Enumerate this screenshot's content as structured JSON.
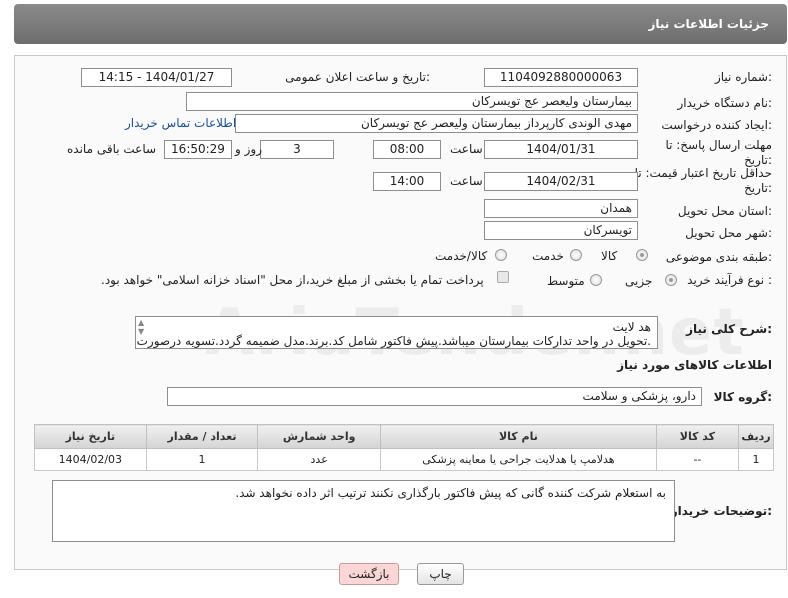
{
  "header": {
    "title": "جزئیات اطلاعات نیاز"
  },
  "form": {
    "need_number_label": "شماره نیاز:",
    "need_number": "1104092880000063",
    "announce_label": "تاریخ و ساعت اعلان عمومی:",
    "announce_value": "1404/01/27 - 14:15",
    "buyer_org_label": "نام دستگاه خریدار:",
    "buyer_org": "بیمارستان ولیعصر  عج  تویسرکان",
    "creator_label": "ایجاد کننده درخواست:",
    "creator": "مهدی الوندی کارپرداز بیمارستان ولیعصر  عج  تویسرکان",
    "contact_link": "اطلاعات تماس خریدار",
    "reply_deadline_label": "مهلت ارسال پاسخ: تا تاریخ:",
    "reply_date": "1404/01/31",
    "time_label": "ساعت",
    "reply_time": "08:00",
    "days_value": "3",
    "days_label": "روز و",
    "remaining_time": "16:50:29",
    "remaining_label": "ساعت باقی مانده",
    "price_deadline_label": "حداقل تاریخ اعتبار قیمت: تا تاریخ:",
    "price_date": "1404/02/31",
    "price_time": "14:00",
    "province_label": "استان محل تحویل:",
    "province": "همدان",
    "city_label": "شهر محل تحویل:",
    "city": "تویسرکان",
    "category_label": "طبقه بندی موضوعی:",
    "category_options": [
      "کالا",
      "خدمت",
      "کالا/خدمت"
    ],
    "process_label": "نوع فرآیند خرید :",
    "process_options": [
      "جزیی",
      "متوسط"
    ],
    "payment_note": "پرداخت تمام یا بخشی از مبلغ خرید،از محل \"اسناد خزانه اسلامی\" خواهد بود."
  },
  "description": {
    "label": "شرح کلی نیاز:",
    "line1": "هد لایت",
    "line2": ".تحویل در واحد تدارکات بیمارستان میباشد.پیش فاکتور شامل کد.برند.مدل ضمیمه گردد.تسویه درصورت"
  },
  "goods": {
    "section_title": "اطلاعات کالاهای مورد نیاز",
    "group_label": "گروه کالا:",
    "group_value": "دارو، پزشکی و سلامت",
    "columns": [
      "ردیف",
      "کد کالا",
      "نام کالا",
      "واحد شمارش",
      "تعداد / مقدار",
      "تاریخ نیاز"
    ],
    "rows": [
      {
        "row": "1",
        "code": "--",
        "name": "هدلامپ یا هدلایت جراحی یا معاینه پزشکی",
        "unit": "عدد",
        "qty": "1",
        "date": "1404/02/03"
      }
    ]
  },
  "buyer_notes": {
    "label": "توضیحات خریدار:",
    "text": "به استعلام شرکت کننده گانی که پیش فاکتور بارگذاری نکنند ترتیب اثر داده نخواهد شد."
  },
  "buttons": {
    "print": "چاپ",
    "back": "بازگشت"
  },
  "watermark": "AriaTender.net"
}
